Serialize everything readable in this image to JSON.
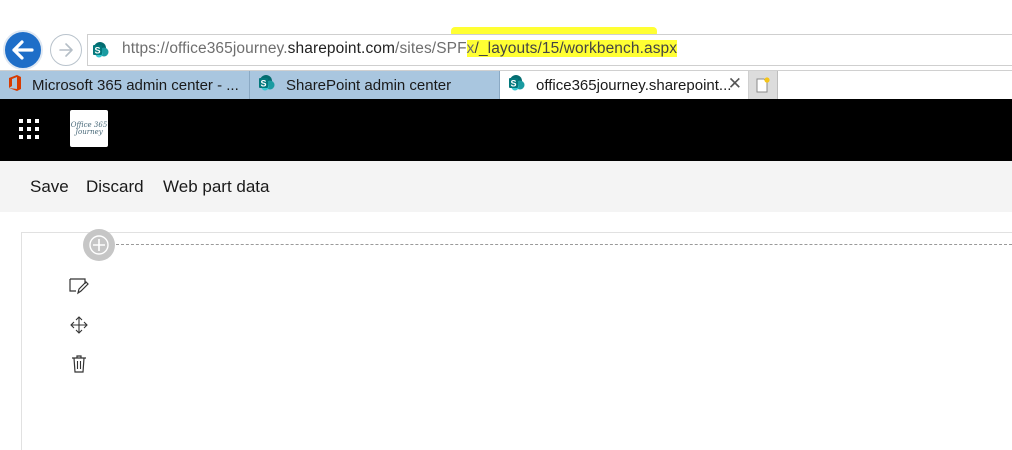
{
  "browser": {
    "url": {
      "host_prefix": "https://",
      "host_sub": "office365journey.",
      "host_domain": "sharepoint.com",
      "path_plain": "/sites/SPF",
      "path_highlight_start": "x",
      "path_highlight": "/_layouts/15/workbench.aspx"
    },
    "tabs": [
      {
        "label": "Microsoft 365 admin center - ...",
        "icon": "office-icon",
        "state": "inactive"
      },
      {
        "label": "SharePoint admin center",
        "icon": "sharepoint-icon",
        "state": "inactive"
      },
      {
        "label": "office365journey.sharepoint...",
        "icon": "sharepoint-icon",
        "state": "active",
        "close": "✕"
      }
    ],
    "icons": {
      "back": "back-arrow-icon",
      "forward": "forward-arrow-icon",
      "new_tab": "new-tab-icon"
    },
    "colors": {
      "back_button": "#1e6ec8",
      "inactive_tab": "#a9c6df",
      "highlight": "#ffff33"
    }
  },
  "suite_bar": {
    "logo_text": "Office 365\nJourney",
    "icons": {
      "app_launcher": "waffle-icon",
      "logo": "site-logo"
    },
    "background": "#000000"
  },
  "command_bar": {
    "save": "Save",
    "discard": "Discard",
    "web_part_data": "Web part data"
  },
  "canvas": {
    "icons": [
      "add-icon",
      "edit-icon",
      "move-icon",
      "delete-icon"
    ]
  }
}
